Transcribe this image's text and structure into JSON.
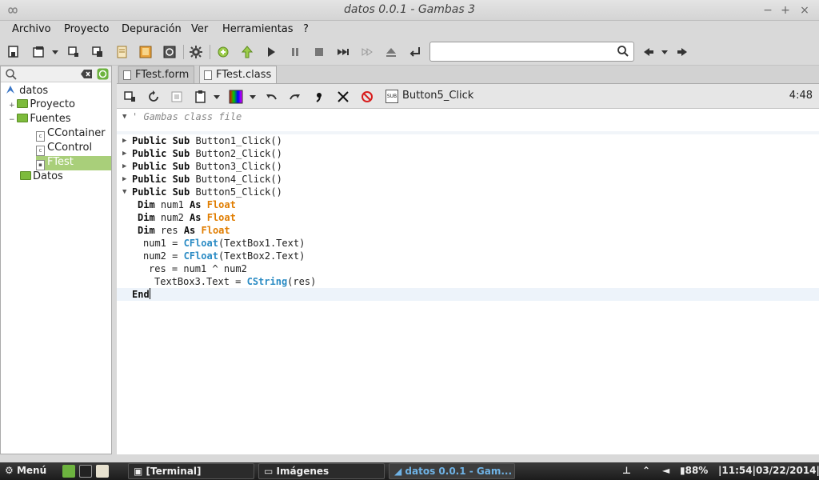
{
  "window": {
    "title": "datos 0.0.1 - Gambas 3",
    "btn_min": "−",
    "btn_max": "+",
    "btn_close": "×"
  },
  "menu": [
    "Archivo",
    "Proyecto",
    "Depuración",
    "Ver",
    "Herramientas",
    "?"
  ],
  "search": {
    "value": "",
    "placeholder": ""
  },
  "tree": {
    "root": "datos",
    "items": [
      "Proyecto",
      "Fuentes",
      "CContainer",
      "CControl",
      "FTest",
      "Datos"
    ]
  },
  "tabs": [
    "FTest.form",
    "FTest.class"
  ],
  "editor": {
    "procedure": "Button5_Click",
    "cursor": "4:48"
  },
  "taskbar": {
    "menu": "Menú",
    "windows": [
      "[Terminal]",
      "Imágenes",
      "datos 0.0.1 - Gam..."
    ],
    "battery": "88%",
    "clock": "|11:54|03/22/2014|"
  },
  "code": {
    "comment": "' Gambas class file",
    "lines": [
      {
        "kw1": "Public Sub",
        "rest": " Button1_Click()"
      },
      {
        "kw1": "Public Sub",
        "rest": " Button2_Click()"
      },
      {
        "kw1": "Public Sub",
        "rest": " Button3_Click()"
      },
      {
        "kw1": "Public Sub",
        "rest": " Button4_Click()"
      },
      {
        "kw1": "Public Sub",
        "rest": " Button5_Click()"
      }
    ],
    "body": {
      "dim": "Dim",
      "as": "As",
      "float": "Float",
      "v1": " num1 ",
      "v2": " num2 ",
      "v3": " res ",
      "a1": "num1 = ",
      "a2": "num2 = ",
      "cfloat": "CFloat",
      "arg1": "(TextBox1.Text)",
      "arg2": "(TextBox2.Text)",
      "res": "res = num1 ^ num2",
      "tb3": "TextBox3.Text = ",
      "cstring": "CString",
      "arg3": "(res)",
      "end": "End"
    }
  }
}
